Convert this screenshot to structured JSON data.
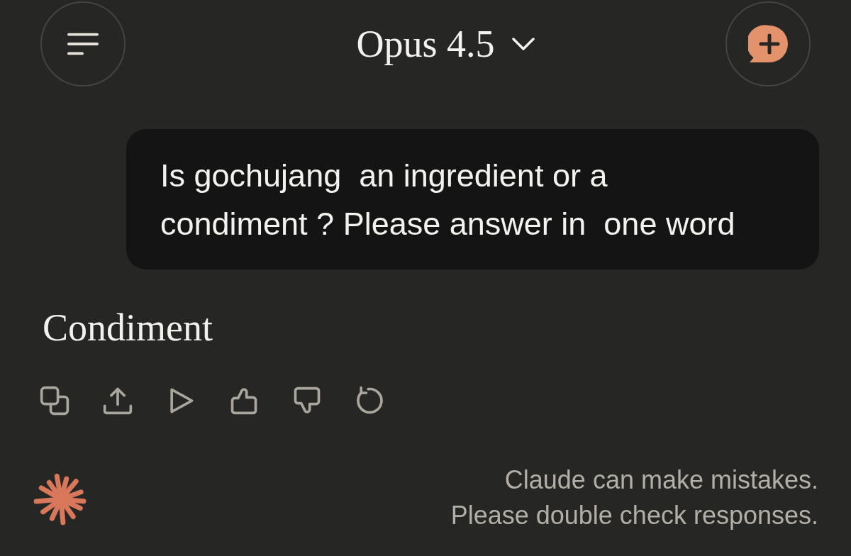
{
  "header": {
    "model": "Opus 4.5"
  },
  "messages": [
    {
      "kind": "user",
      "text": "Is gochujang  an ingredient or a condiment ? Please answer in  one word"
    },
    {
      "kind": "assistant",
      "text": "Condiment"
    }
  ],
  "footer": {
    "disclaimer": [
      "Claude can make mistakes.",
      "Please double check responses."
    ]
  }
}
